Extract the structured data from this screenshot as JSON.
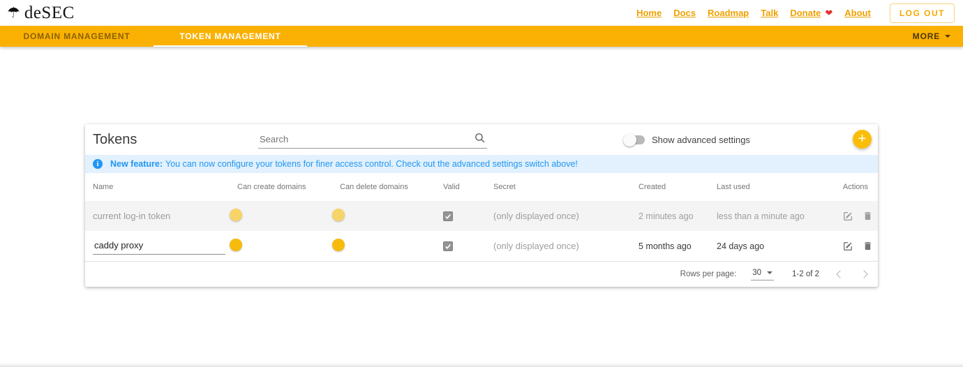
{
  "header": {
    "brand": "deSEC",
    "nav": [
      "Home",
      "Docs",
      "Roadmap",
      "Talk",
      "Donate",
      "About"
    ],
    "logout_label": "LOG OUT"
  },
  "tabs": {
    "domain": "DOMAIN MANAGEMENT",
    "token": "TOKEN MANAGEMENT",
    "active": "TOKEN MANAGEMENT",
    "more": "MORE"
  },
  "panel": {
    "title": "Tokens",
    "search_placeholder": "Search",
    "advanced_toggle_label": "Show advanced settings",
    "advanced_toggle_state": "off",
    "add_button": "+"
  },
  "banner": {
    "bold": "New feature:",
    "text": "You can now configure your tokens for finer access control. Check out the advanced settings switch above!"
  },
  "table": {
    "columns": [
      "Name",
      "Can create domains",
      "Can delete domains",
      "Valid",
      "Secret",
      "Created",
      "Last used",
      "Actions"
    ],
    "rows": [
      {
        "name": "current log-in token",
        "can_create_domains": true,
        "can_delete_domains": true,
        "valid": true,
        "secret": "(only displayed once)",
        "created": "2 minutes ago",
        "last_used": "less than a minute ago"
      },
      {
        "name": "caddy proxy",
        "can_create_domains": true,
        "can_delete_domains": true,
        "valid": true,
        "secret": "(only displayed once)",
        "created": "5 months ago",
        "last_used": "24 days ago"
      }
    ]
  },
  "pagination": {
    "rows_per_page_label": "Rows per page:",
    "rows_per_page_value": "30",
    "range": "1-2 of 2"
  },
  "colors": {
    "primary_amber": "#fbb104",
    "fab_amber": "#fbbe08",
    "link_amber": "#efa100",
    "banner_blue": "#2196f3",
    "banner_bg": "#e2f1fd",
    "heart_red": "#e5312f",
    "muted_row_bg": "#f4f4f4"
  }
}
